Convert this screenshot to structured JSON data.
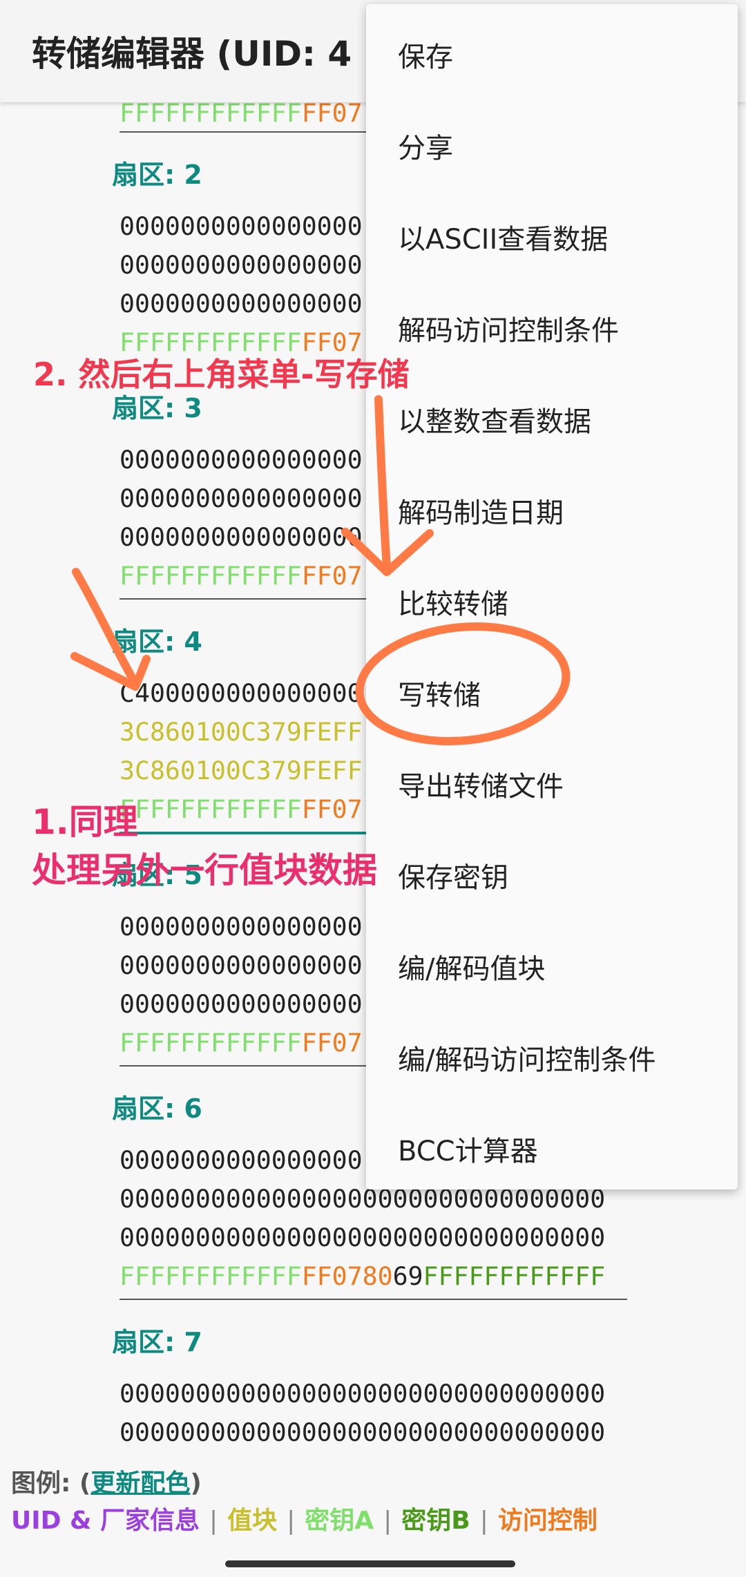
{
  "appbar": {
    "title": "转储编辑器 (UID: 4"
  },
  "menu": {
    "items": [
      "保存",
      "分享",
      "以ASCII查看数据",
      "解码访问控制条件",
      "以整数查看数据",
      "解码制造日期",
      "比较转储",
      "写转储",
      "导出转储文件",
      "保存密钥",
      "编/解码值块",
      "编/解码访问控制条件",
      "BCC计算器"
    ]
  },
  "dump": {
    "line_top": {
      "green": "FFFFFFFFFFFF",
      "orange": "FF07"
    },
    "sector2": {
      "label": "扇区: 2",
      "lines": [
        "0000000000000000",
        "0000000000000000",
        "0000000000000000"
      ],
      "trailer_green": "FFFFFFFFFFFF",
      "trailer_orange": "FF07"
    },
    "sector3": {
      "label": "扇区: 3",
      "lines": [
        "0000000000000000",
        "0000000000000000",
        "0000000000000000"
      ],
      "trailer_green": "FFFFFFFFFFFF",
      "trailer_orange": "FF07"
    },
    "sector4": {
      "label": "扇区: 4",
      "line1": "C400000000000000",
      "value1": "3C860100C379FEFF",
      "value2": "3C860100C379FEFF",
      "trailer_green": "FFFFFFFFFFFF",
      "trailer_orange": "FF07"
    },
    "sector5": {
      "label": "扇区: 5",
      "lines": [
        "0000000000000000",
        "0000000000000000",
        "0000000000000000"
      ],
      "trailer_green": "FFFFFFFFFFFF",
      "trailer_orange": "FF07"
    },
    "sector6": {
      "label": "扇区: 6",
      "line1": "0000000000000000",
      "line2": "00000000000000000000000000000000",
      "line3": "00000000000000000000000000000000",
      "t_green": "FFFFFFFFFFFF",
      "t_orange": "FF0780",
      "t_black": "69",
      "t_green2": "FFFFFFFFFFFF"
    },
    "sector7": {
      "label": "扇区: 7",
      "line1": "00000000000000000000000000000000",
      "line2": "00000000000000000000000000000000"
    }
  },
  "legend": {
    "title": "图例: (",
    "link": "更新配色",
    "close": ")",
    "uid": "UID & 厂家信息",
    "value": "值块",
    "keyA": "密钥A",
    "keyB": "密钥B",
    "access": "访问控制",
    "sep": "|"
  },
  "annotations": {
    "step2": "2. 然后右上角菜单-写存储",
    "step1_line1": "1.同理",
    "step1_line2": "处理另外一行值块数据"
  },
  "colors": {
    "accent": "#0f8a80",
    "annotation": "#f2384f",
    "arrow": "#ff7a45"
  }
}
